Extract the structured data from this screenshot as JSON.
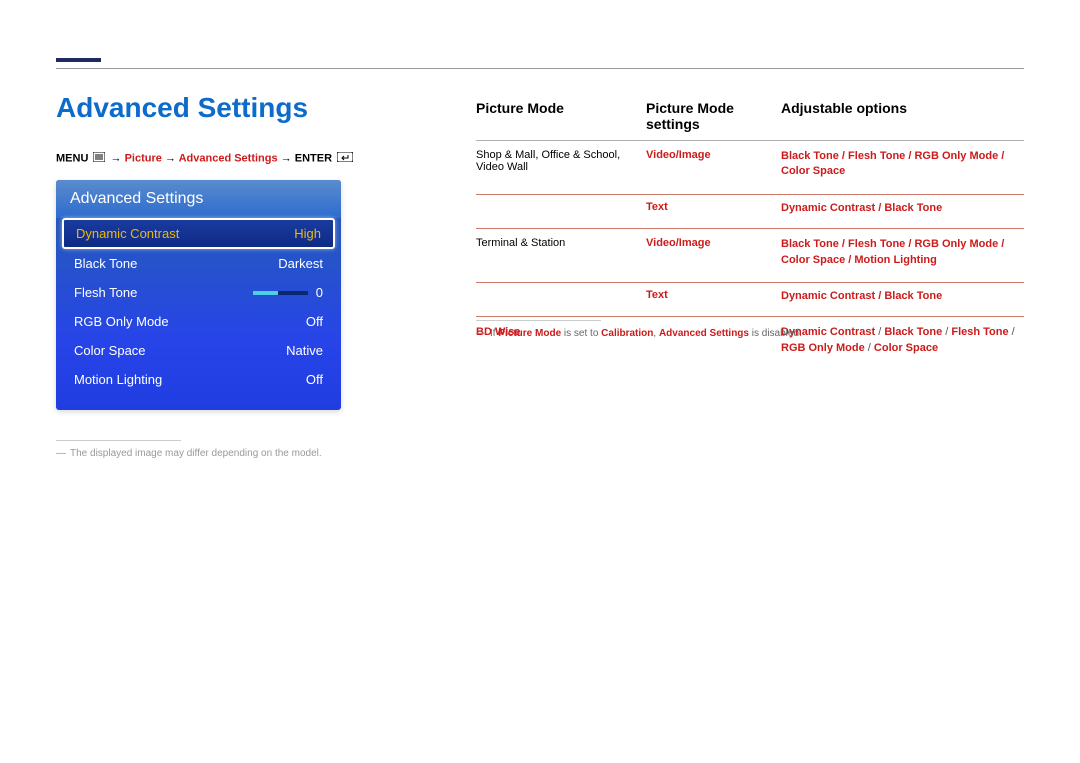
{
  "title": "Advanced Settings",
  "breadcrumb": {
    "menu": "MENU",
    "picture": "Picture",
    "advanced": "Advanced Settings",
    "enter": "ENTER"
  },
  "panel": {
    "title": "Advanced Settings",
    "rows": [
      {
        "label": "Dynamic Contrast",
        "value": "High",
        "selected": true
      },
      {
        "label": "Black Tone",
        "value": "Darkest"
      },
      {
        "label": "Flesh Tone",
        "value": "0",
        "slider": true
      },
      {
        "label": "RGB Only Mode",
        "value": "Off"
      },
      {
        "label": "Color Space",
        "value": "Native"
      },
      {
        "label": "Motion Lighting",
        "value": "Off"
      }
    ]
  },
  "footnote_panel": "The displayed image may differ depending on the model.",
  "columns": {
    "h1": "Picture Mode",
    "h2": "Picture Mode settings",
    "h3": "Adjustable options"
  },
  "table": {
    "g1": {
      "mode_a": "Shop & Mall",
      "mode_b": "Office & School",
      "mode_c": "Video Wall",
      "r1_setting": "Video/Image",
      "r1_opts": {
        "a": "Black Tone",
        "b": "Flesh Tone",
        "c": "RGB Only Mode",
        "d": "Color Space"
      },
      "r2_setting": "Text",
      "r2_opts": {
        "a": "Dynamic Contrast",
        "b": "Black Tone"
      }
    },
    "g2": {
      "mode": "Terminal & Station",
      "r1_setting": "Video/Image",
      "r1_opts": {
        "a": "Black Tone",
        "b": "Flesh Tone",
        "c": "RGB Only Mode",
        "d": "Color Space",
        "e": "Motion Lighting"
      },
      "r2_setting": "Text",
      "r2_opts": {
        "a": "Dynamic Contrast",
        "b": "Black Tone"
      }
    },
    "g3": {
      "mode": "BD Wise",
      "opts": {
        "a": "Dynamic Contrast",
        "b": "Black Tone",
        "c": "Flesh Tone",
        "d": "RGB Only Mode",
        "e": "Color Space"
      }
    }
  },
  "note": {
    "prefix": "If ",
    "pm": "Picture Mode",
    "mid1": " is set to ",
    "cal": "Calibration",
    "mid2": ", ",
    "as": "Advanced Settings",
    "suffix": " is disabled."
  },
  "sep": " / ",
  "comma": ", ",
  "arrow": " → "
}
